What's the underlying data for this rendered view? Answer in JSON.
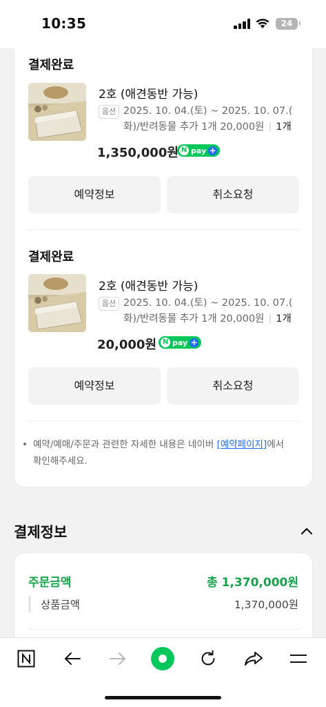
{
  "status": {
    "time": "10:35",
    "battery": "24"
  },
  "orders": [
    {
      "status": "결제완료",
      "product_name": "2호 (애견동반 가능)",
      "option_badge": "옵션",
      "option_line1": "2025. 10. 04.(토) ~ 2025. 10. 07.(",
      "option_line2": "화)/반려동물 추가 1개 20,000원",
      "quantity": "1개",
      "price": "1,350,000원",
      "pay_badge": "pay",
      "btn_reservation": "예약정보",
      "btn_cancel": "취소요청"
    },
    {
      "status": "결제완료",
      "product_name": "2호 (애견동반 가능)",
      "option_badge": "옵션",
      "option_line1": "2025. 10. 04.(토) ~ 2025. 10. 07.(",
      "option_line2": "화)/반려동물 추가 1개 20,000원",
      "quantity": "1개",
      "price": "20,000원",
      "pay_badge": "pay",
      "btn_reservation": "예약정보",
      "btn_cancel": "취소요청"
    }
  ],
  "notice": {
    "bullet": "•",
    "text_before": "예약/예매/주문과 관련한 자세한 내용은 네이버 ",
    "link": "[예약페이지]",
    "text_after": "에서",
    "line2": "확인해주세요."
  },
  "payment_info": {
    "title": "결제정보",
    "order_amount_label": "주문금액",
    "order_amount_total": "총 1,370,000원",
    "product_amount_label": "상품금액",
    "product_amount_value": "1,370,000원"
  },
  "toolbar": {
    "icons": [
      "naver-home-icon",
      "back-arrow-icon",
      "forward-arrow-icon",
      "green-dot-icon",
      "refresh-icon",
      "share-icon",
      "menu-icon"
    ]
  },
  "colors": {
    "accent_green": "#16a34a",
    "npay_green": "#03c75a",
    "link_blue": "#1f6cf0"
  }
}
